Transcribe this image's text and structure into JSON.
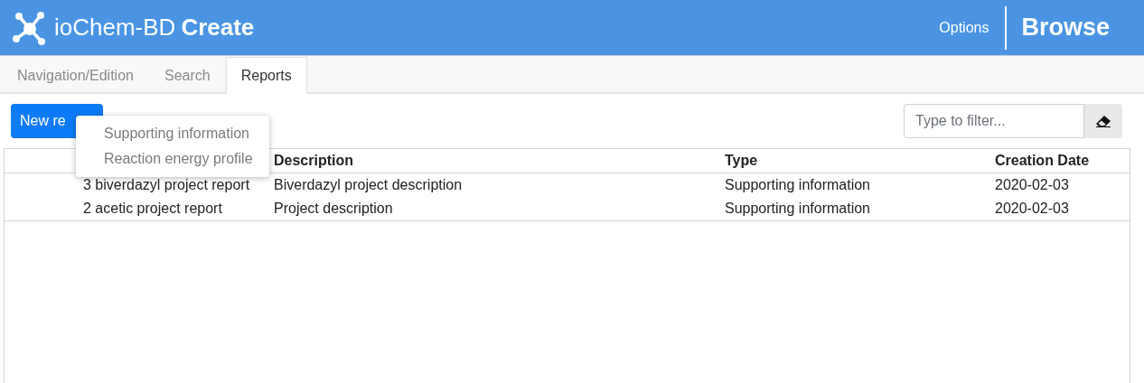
{
  "header": {
    "brand": "ioChem-BD",
    "product": "Create",
    "nav": [
      {
        "label": "Options",
        "kind": "link"
      },
      {
        "label": "Browse",
        "kind": "brand"
      }
    ]
  },
  "tabs": [
    {
      "label": "Navigation/Edition",
      "selected": false
    },
    {
      "label": "Search",
      "selected": false
    },
    {
      "label": "Reports",
      "selected": true
    }
  ],
  "toolbar": {
    "new_button": "New re",
    "filter": {
      "placeholder": "Type to filter..."
    }
  },
  "menu": {
    "items": [
      "Supporting information",
      "Reaction energy profile"
    ]
  },
  "table": {
    "columns": [
      "",
      "Description",
      "Type",
      "Creation Date"
    ],
    "rows": [
      [
        "3 biverdazyl project report",
        "Biverdazyl project description",
        "Supporting information",
        "2020-02-03"
      ],
      [
        "2 acetic project report",
        "Project description",
        "Supporting information",
        "2020-02-03"
      ]
    ]
  }
}
